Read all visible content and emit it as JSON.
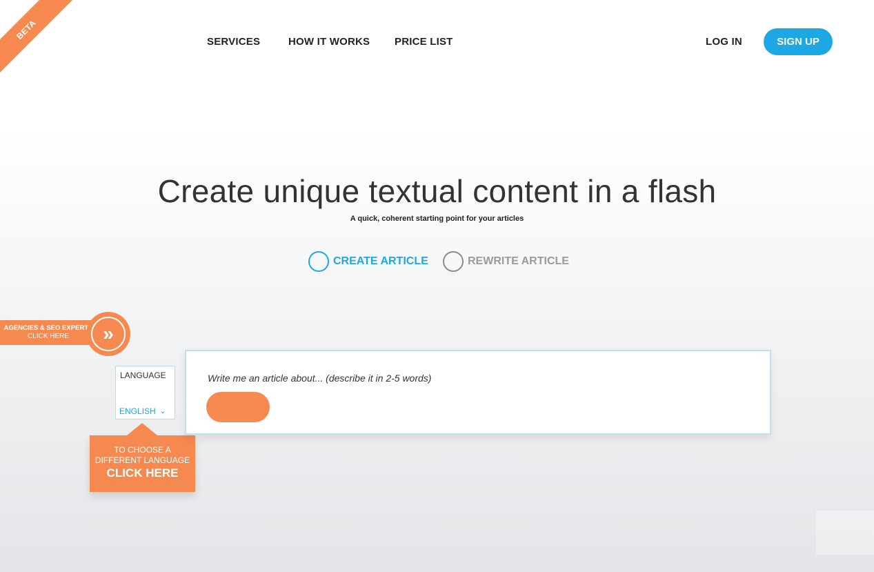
{
  "badge": {
    "beta": "BETA"
  },
  "nav": {
    "services": "SERVICES",
    "how_it_works": "HOW IT WORKS",
    "price_list": "PRICE LIST",
    "log_in": "LOG IN",
    "sign_up": "SIGN UP"
  },
  "hero": {
    "title": "Create unique textual content in a flash",
    "subtitle": "A quick, coherent starting point for your articles"
  },
  "modes": {
    "create": "CREATE ARTICLE",
    "rewrite": "REWRITE ARTICLE"
  },
  "agencies": {
    "line1": "AGENCIES & SEO EXPERTS",
    "line2": "CLICK HERE",
    "arrow_icon": "»"
  },
  "language": {
    "label": "LANGUAGE",
    "selected": "ENGLISH",
    "chevron_icon": "⌄"
  },
  "tooltip": {
    "line1": "TO CHOOSE A",
    "line2": "DIFFERENT LANGUAGE",
    "line3": "CLICK HERE"
  },
  "article": {
    "placeholder": "Write me an article about... (describe it in 2-5 words)",
    "value": ""
  },
  "colors": {
    "accent_blue": "#1ea7e5",
    "accent_orange": "#f5894f",
    "text_dark": "#222222"
  }
}
